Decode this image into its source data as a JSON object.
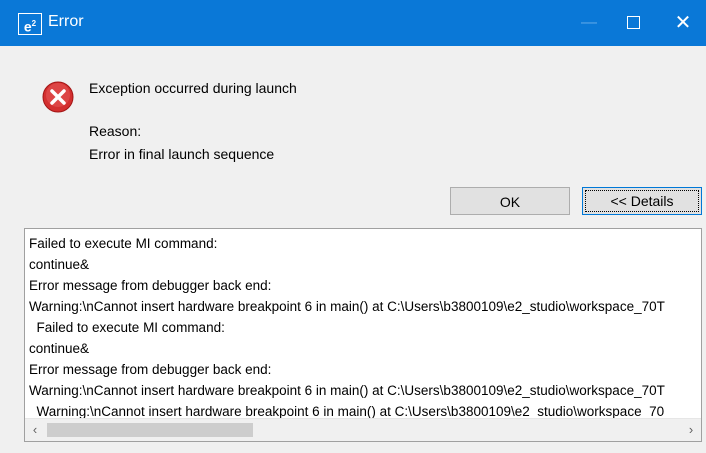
{
  "window": {
    "title": "Error",
    "app_icon": "e²"
  },
  "message": {
    "main": "Exception occurred during launch",
    "reason_label": "Reason:",
    "reason_text": "Error in final launch sequence"
  },
  "buttons": {
    "ok": "OK",
    "details": "<< Details"
  },
  "details": {
    "lines": [
      "Failed to execute MI command:",
      "continue&",
      "Error message from debugger back end:",
      "Warning:\\nCannot insert hardware breakpoint 6 in main() at C:\\Users\\b3800109\\e2_studio\\workspace_70T",
      "  Failed to execute MI command:",
      "continue&",
      "Error message from debugger back end:",
      "Warning:\\nCannot insert hardware breakpoint 6 in main() at C:\\Users\\b3800109\\e2_studio\\workspace_70T",
      "  Warning:\\nCannot insert hardware breakpoint 6 in main() at C:\\Users\\b3800109\\e2_studio\\workspace_70"
    ],
    "scroll_position": 0
  },
  "icons": {
    "error": "error-icon",
    "close": "close-icon",
    "maximize": "maximize-icon",
    "minimize": "minimize-icon"
  },
  "colors": {
    "titlebar": "#0a78d7",
    "error_red": "#d32f2f",
    "focus_border": "#0078d7"
  }
}
